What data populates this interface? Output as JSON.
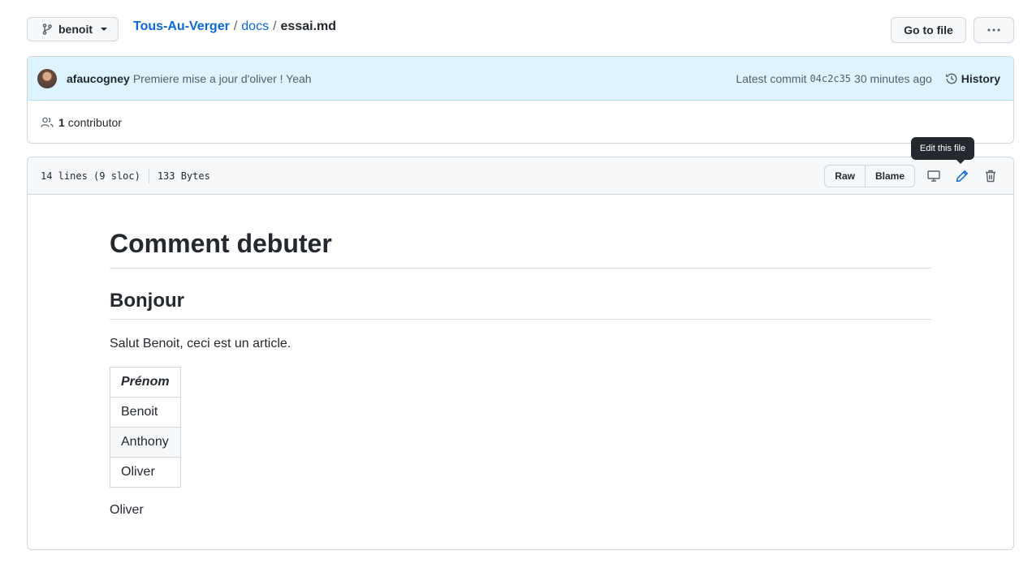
{
  "branch": {
    "name": "benoit"
  },
  "breadcrumb": {
    "repo": "Tous-Au-Verger",
    "folder": "docs",
    "file": "essai.md",
    "separator": "/"
  },
  "top_actions": {
    "go_to_file": "Go to file"
  },
  "commit": {
    "author": "afaucogney",
    "message": "Premiere mise a jour d'oliver ! Yeah",
    "latest_label": "Latest commit",
    "sha": "04c2c35",
    "time": "30 minutes ago",
    "history_label": "History"
  },
  "contributors": {
    "count": "1",
    "label": "contributor"
  },
  "file_header": {
    "lines": "14 lines (9 sloc)",
    "size": "133 Bytes",
    "raw_label": "Raw",
    "blame_label": "Blame",
    "tooltip": "Edit this file",
    "icons": [
      "desktop-icon",
      "pencil-icon",
      "trash-icon"
    ]
  },
  "markdown": {
    "h1": "Comment debuter",
    "h2": "Bonjour",
    "paragraph": "Salut Benoit, ceci est un article.",
    "table": {
      "header": "Prénom",
      "rows": [
        "Benoit",
        "Anthony",
        "Oliver"
      ]
    },
    "footer": "Oliver"
  },
  "colors": {
    "link": "#0969da",
    "commit_bg": "#ddf4ff",
    "tooltip_bg": "#24292f"
  }
}
